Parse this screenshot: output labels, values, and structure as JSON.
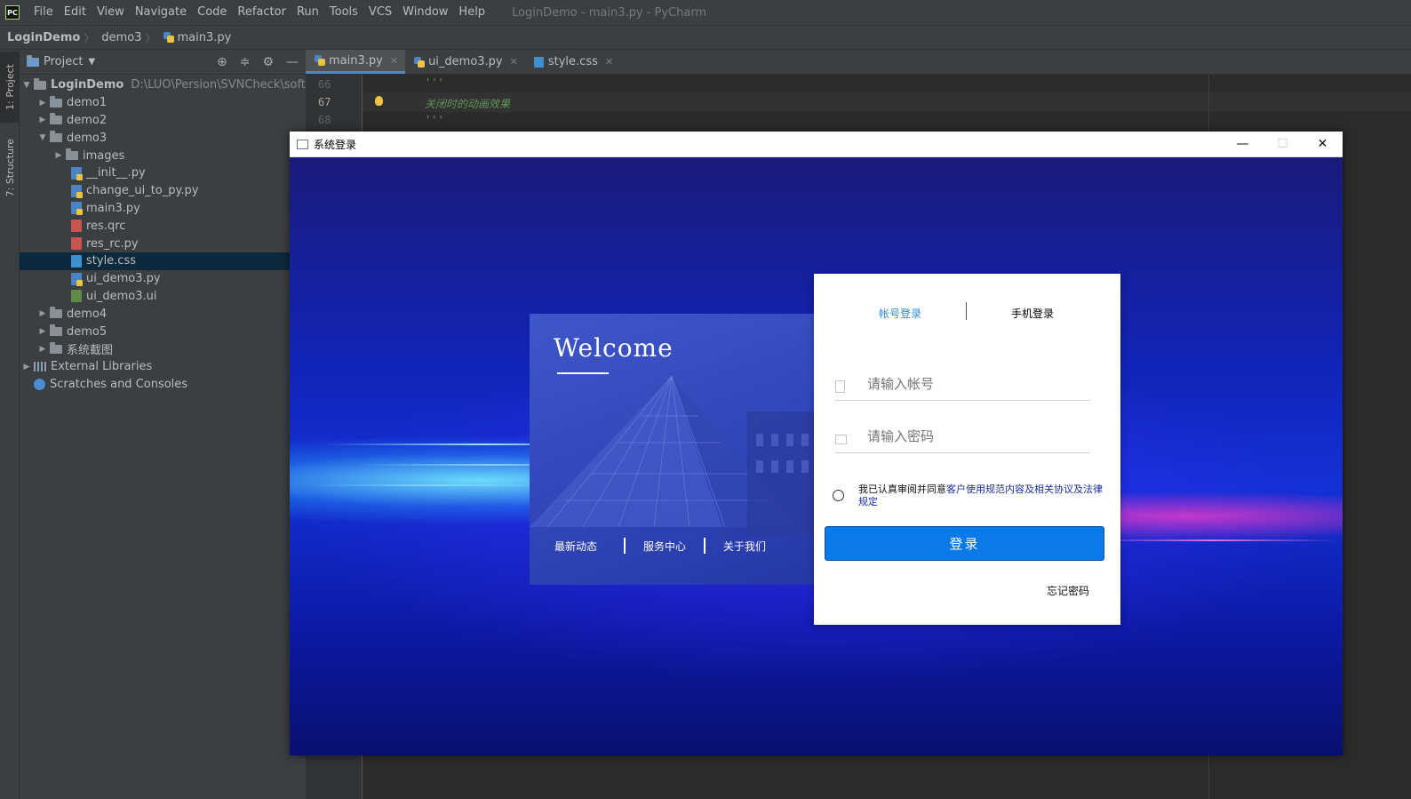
{
  "menubar": {
    "logo": "PC",
    "items": [
      "File",
      "Edit",
      "View",
      "Navigate",
      "Code",
      "Refactor",
      "Run",
      "Tools",
      "VCS",
      "Window",
      "Help"
    ],
    "window_title": "LoginDemo - main3.py - PyCharm"
  },
  "breadcrumb": {
    "project": "LoginDemo",
    "folder": "demo3",
    "file": "main3.py"
  },
  "tool_strip": {
    "project_tab": "1: Project",
    "structure_tab": "7: Structure"
  },
  "project_panel": {
    "title": "Project",
    "tree": [
      {
        "label": "LoginDemo",
        "path": "D:\\LUO\\Persion\\SVNCheck\\software"
      },
      {
        "label": "demo1"
      },
      {
        "label": "demo2"
      },
      {
        "label": "demo3"
      },
      {
        "label": "images"
      },
      {
        "label": "__init__.py"
      },
      {
        "label": "change_ui_to_py.py"
      },
      {
        "label": "main3.py"
      },
      {
        "label": "res.qrc"
      },
      {
        "label": "res_rc.py"
      },
      {
        "label": "style.css"
      },
      {
        "label": "ui_demo3.py"
      },
      {
        "label": "ui_demo3.ui"
      },
      {
        "label": "demo4"
      },
      {
        "label": "demo5"
      },
      {
        "label": "系统截图"
      },
      {
        "label": "External Libraries"
      },
      {
        "label": "Scratches and Consoles"
      }
    ]
  },
  "editor": {
    "tabs": [
      "main3.py",
      "ui_demo3.py",
      "style.css"
    ],
    "line_numbers": [
      "66",
      "67",
      "68"
    ],
    "lines": [
      "'''",
      "关闭时的动画效果",
      "'''"
    ]
  },
  "login_window": {
    "title": "系统登录",
    "welcome": "Welcome",
    "card_links": [
      "最新动态",
      "服务中心",
      "关于我们"
    ],
    "tabs": {
      "account": "帐号登录",
      "phone": "手机登录"
    },
    "account_placeholder": "请输入帐号",
    "password_placeholder": "请输入密码",
    "agree_prefix": "我已认真审阅并同意",
    "agree_link": "客户使用规范内容及相关协议及法律规定",
    "login_button": "登录",
    "forgot": "忘记密码",
    "colors": {
      "accent": "#0b7ae8",
      "tab_active": "#2f8cd8",
      "link": "#1b2fa6"
    }
  }
}
